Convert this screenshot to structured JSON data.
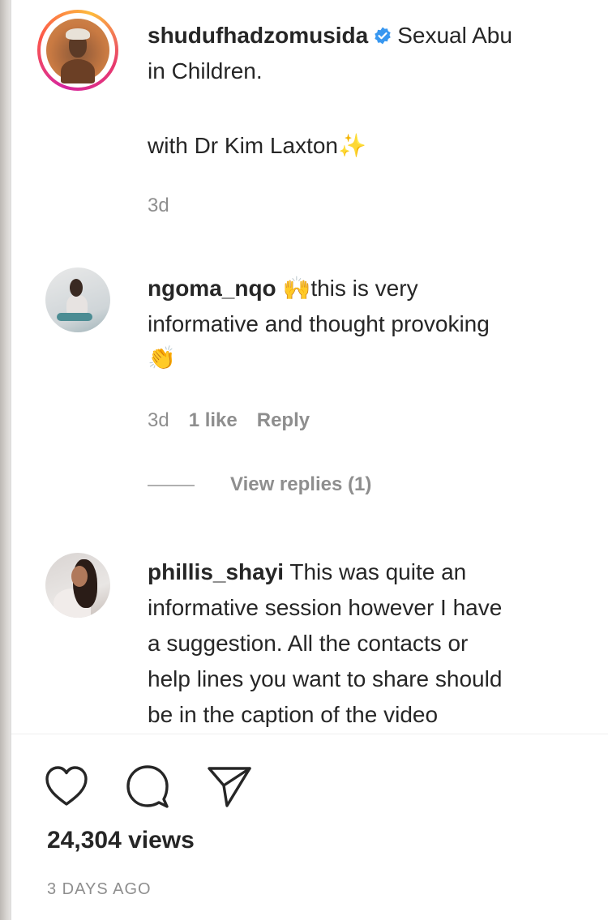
{
  "caption": {
    "username": "shudufhadzomusida",
    "text_line1": "Sexual Abu",
    "text_line2": "in Children.",
    "text_line3": "with Dr Kim Laxton",
    "emoji": "✨",
    "age": "3d"
  },
  "comments": [
    {
      "username": "ngoma_nqo",
      "emoji_lead": "🙌",
      "line1": "this is very",
      "line2": "informative and thought provoking",
      "emoji_tail": "👏",
      "age": "3d",
      "likes": "1 like",
      "reply": "Reply",
      "view_replies": "View replies (1)"
    },
    {
      "username": "phillis_shayi",
      "line1": "This was quite an",
      "line2": "informative session however I have",
      "line3": "a suggestion. All the contacts or",
      "line4": "help lines you want to share should",
      "line5": "be in the caption of the video"
    }
  ],
  "actions": {
    "like_icon": "heart-icon",
    "comment_icon": "comment-icon",
    "share_icon": "share-icon"
  },
  "views": "24,304 views",
  "timestamp": "3 DAYS AGO",
  "colors": {
    "text": "#262626",
    "muted": "#8e8e8e",
    "verified": "#3897f0"
  }
}
